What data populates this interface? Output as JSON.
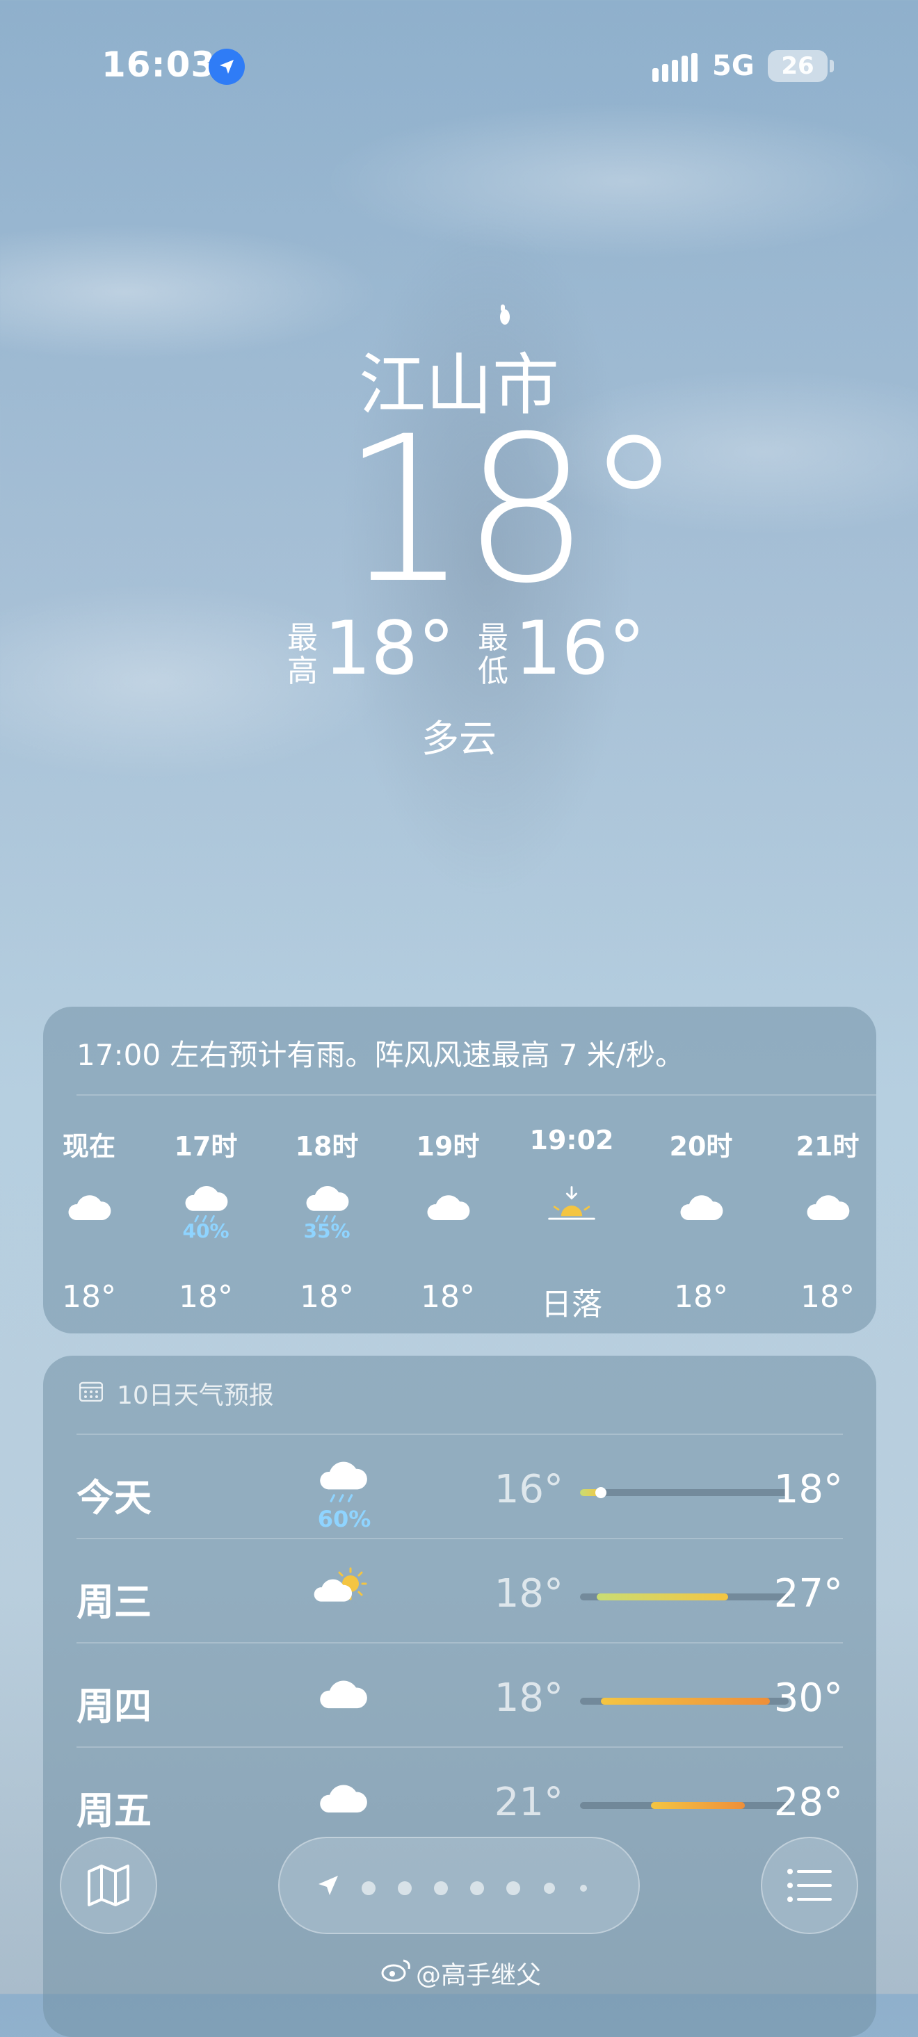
{
  "status_bar": {
    "time": "16:03",
    "network": "5G",
    "battery": "26"
  },
  "header": {
    "city": "江山市",
    "temperature": "18°",
    "high_label": "最高",
    "high": "18°",
    "low_label": "最低",
    "low": "16°",
    "condition": "多云"
  },
  "hourly": {
    "summary": "17:00 左右预计有雨。阵风风速最高 7 米/秒。",
    "items": [
      {
        "label": "现在",
        "icon": "cloud-icon",
        "pop": "",
        "temp": "18°"
      },
      {
        "label": "17时",
        "icon": "cloud-rain-icon",
        "pop": "40%",
        "temp": "18°"
      },
      {
        "label": "18时",
        "icon": "cloud-rain-icon",
        "pop": "35%",
        "temp": "18°"
      },
      {
        "label": "19时",
        "icon": "cloud-icon",
        "pop": "",
        "temp": "18°"
      },
      {
        "label": "19:02",
        "icon": "sunset-icon",
        "pop": "",
        "temp": "日落"
      },
      {
        "label": "20时",
        "icon": "cloud-icon",
        "pop": "",
        "temp": "18°"
      },
      {
        "label": "21时",
        "icon": "cloud-icon",
        "pop": "",
        "temp": "18°"
      }
    ]
  },
  "daily": {
    "title": "10日天气预报",
    "days": [
      {
        "name": "今天",
        "icon": "cloud-rain-icon",
        "pop": "60%",
        "low": "16°",
        "high": "18°",
        "range_start": 0.0,
        "range_end": 0.1,
        "current": 0.1
      },
      {
        "name": "周三",
        "icon": "sun-cloud-icon",
        "pop": "",
        "low": "18°",
        "high": "27°",
        "range_start": 0.08,
        "range_end": 0.71
      },
      {
        "name": "周四",
        "icon": "cloud-icon",
        "pop": "",
        "low": "18°",
        "high": "30°",
        "range_start": 0.1,
        "range_end": 0.91
      },
      {
        "name": "周五",
        "icon": "cloud-icon",
        "pop": "",
        "low": "21°",
        "high": "28°",
        "range_start": 0.34,
        "range_end": 0.79
      }
    ]
  },
  "watermark": "@高手继父",
  "colors": {
    "accent_blue": "#2f7cf6",
    "precip": "#8fd4ff",
    "temp_cool": "#c9dd74",
    "temp_warm": "#f4c542",
    "temp_hot": "#ee8f3a"
  }
}
